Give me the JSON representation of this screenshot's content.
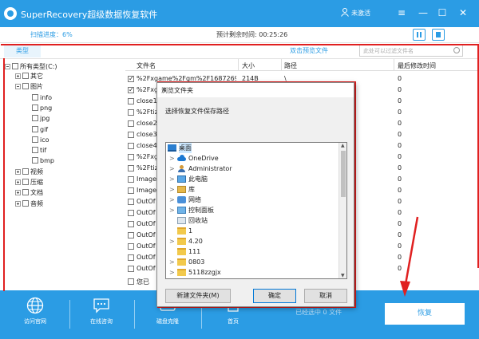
{
  "app": {
    "title": "SuperRecovery超级数据恢复软件",
    "user_status": "未激活",
    "window_buttons": [
      "≡",
      "—",
      "☐",
      "✕"
    ]
  },
  "status": {
    "progress_label": "扫描进度：6%",
    "time_left_label": "预计剩余时间:",
    "time_left_value": "00:25:26"
  },
  "tabs": {
    "type_tab": "类型",
    "preview_link": "双击预览文件",
    "search_placeholder": "此处可以过滤文件名"
  },
  "tree": {
    "root": "所有类型(C:)",
    "items": [
      {
        "label": "其它",
        "level": 1,
        "expander": "plus"
      },
      {
        "label": "图片",
        "level": 1,
        "expander": "minus"
      },
      {
        "label": "info",
        "level": 2
      },
      {
        "label": "png",
        "level": 2
      },
      {
        "label": "jpg",
        "level": 2
      },
      {
        "label": "gif",
        "level": 2
      },
      {
        "label": "ico",
        "level": 2
      },
      {
        "label": "tif",
        "level": 2
      },
      {
        "label": "bmp",
        "level": 2
      },
      {
        "label": "视频",
        "level": 1,
        "expander": "plus"
      },
      {
        "label": "压缩",
        "level": 1,
        "expander": "plus"
      },
      {
        "label": "文档",
        "level": 1,
        "expander": "plus"
      },
      {
        "label": "音频",
        "level": 1,
        "expander": "plus"
      }
    ]
  },
  "filelist": {
    "columns": {
      "name": "文件名",
      "size": "大小",
      "path": "路径",
      "modified": "最后修改时间"
    },
    "rows": [
      {
        "name": "%2Fxgame%2Fgm%2F1687269...",
        "size": "214B",
        "path": "\\",
        "modified": "0",
        "checked": true
      },
      {
        "name": "%2Fxg",
        "size": "",
        "path": "",
        "modified": "0",
        "checked": true
      },
      {
        "name": "close1",
        "size": "",
        "path": "",
        "modified": "0",
        "checked": false
      },
      {
        "name": "%2Ftiz",
        "size": "",
        "path": "",
        "modified": "0",
        "checked": false
      },
      {
        "name": "close2",
        "size": "",
        "path": "",
        "modified": "0",
        "checked": false
      },
      {
        "name": "close3",
        "size": "",
        "path": "",
        "modified": "0",
        "checked": false
      },
      {
        "name": "close4",
        "size": "",
        "path": "",
        "modified": "0",
        "checked": false
      },
      {
        "name": "%2Fxg",
        "size": "",
        "path": "",
        "modified": "0",
        "checked": false
      },
      {
        "name": "%2Ftiz",
        "size": "",
        "path": "",
        "modified": "0",
        "checked": false
      },
      {
        "name": "Image",
        "size": "",
        "path": "",
        "modified": "0",
        "checked": false
      },
      {
        "name": "Image",
        "size": "",
        "path": "",
        "modified": "0",
        "checked": false
      },
      {
        "name": "OutOf",
        "size": "",
        "path": "",
        "modified": "0",
        "checked": false
      },
      {
        "name": "OutOf",
        "size": "",
        "path": "",
        "modified": "0",
        "checked": false
      },
      {
        "name": "OutOf",
        "size": "",
        "path": "",
        "modified": "0",
        "checked": false
      },
      {
        "name": "OutOf",
        "size": "",
        "path": "",
        "modified": "0",
        "checked": false
      },
      {
        "name": "OutOf",
        "size": "",
        "path": "",
        "modified": "0",
        "checked": false
      },
      {
        "name": "OutOf",
        "size": "",
        "path": "",
        "modified": "0",
        "checked": false
      },
      {
        "name": "OutOf",
        "size": "",
        "path": "",
        "modified": "0",
        "checked": false
      }
    ],
    "select_all": "您已"
  },
  "bottombar": {
    "items": [
      "访问官网",
      "在线咨询",
      "磁盘克隆",
      "首页"
    ],
    "info_text": "已经选中 0 文件",
    "recover_button": "恢复"
  },
  "dialog": {
    "title": "浏览文件夹",
    "prompt": "选择恢复文件保存路径",
    "nodes": [
      {
        "label": "桌面",
        "icon": "desktop",
        "indent": 0,
        "chevron": "",
        "selected": true
      },
      {
        "label": "OneDrive",
        "icon": "cloud",
        "indent": 1,
        "chevron": ">"
      },
      {
        "label": "Administrator",
        "icon": "user",
        "indent": 1,
        "chevron": ">"
      },
      {
        "label": "此电脑",
        "icon": "pc",
        "indent": 1,
        "chevron": ">"
      },
      {
        "label": "库",
        "icon": "lib",
        "indent": 1,
        "chevron": ">"
      },
      {
        "label": "网络",
        "icon": "net",
        "indent": 1,
        "chevron": ">"
      },
      {
        "label": "控制面板",
        "icon": "ctrl",
        "indent": 1,
        "chevron": ">"
      },
      {
        "label": "回收站",
        "icon": "bin",
        "indent": 1,
        "chevron": ""
      },
      {
        "label": "1",
        "icon": "folder",
        "indent": 1,
        "chevron": ""
      },
      {
        "label": "4.20",
        "icon": "folder",
        "indent": 1,
        "chevron": ">"
      },
      {
        "label": "111",
        "icon": "folder",
        "indent": 1,
        "chevron": ""
      },
      {
        "label": "0803",
        "icon": "folder",
        "indent": 1,
        "chevron": ">"
      },
      {
        "label": "5118zzgjx",
        "icon": "folder",
        "indent": 1,
        "chevron": ">"
      }
    ],
    "new_folder_button": "新建文件夹(M)",
    "ok_button": "确定",
    "cancel_button": "取消"
  },
  "colors": {
    "accent": "#2b9ce4",
    "annotation": "#e02020"
  }
}
